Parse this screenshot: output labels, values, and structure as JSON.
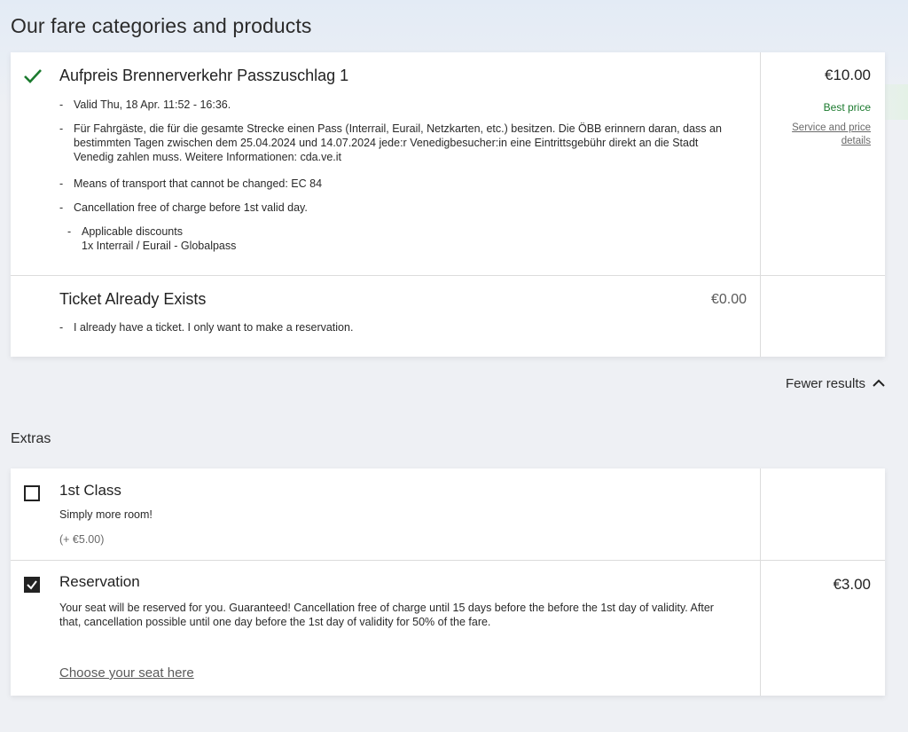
{
  "page": {
    "title": "Our fare categories and products"
  },
  "fares": [
    {
      "title": "Aufpreis Brennerverkehr Passzuschlag 1",
      "price": "€10.00",
      "badge": "Best price",
      "service_link_line1": "Service and price",
      "service_link_line2": "details",
      "details": [
        "Valid Thu, 18 Apr. 11:52 - 16:36.",
        "Für Fahrgäste, die für die gesamte Strecke einen Pass (Interrail, Eurail, Netzkarten, etc.) besitzen. Die ÖBB erinnern daran, dass an bestimmten Tagen zwischen dem 25.04.2024 und 14.07.2024 jede:r Venedigbesucher:in eine Eintrittsgebühr direkt an die Stadt Venedig zahlen muss. Weitere Informationen: cda.ve.it",
        "Means of transport that cannot be changed: EC 84",
        "Cancellation free of charge before 1st valid day."
      ],
      "discounts_label": "Applicable discounts",
      "discounts_value": "1x Interrail / Eurail - Globalpass",
      "selected": true
    },
    {
      "title": "Ticket Already Exists",
      "price": "€0.00",
      "details": [
        "I already have a ticket. I only want to make a reservation."
      ]
    }
  ],
  "toggle": {
    "fewer_label": "Fewer results"
  },
  "extras": {
    "title": "Extras",
    "items": [
      {
        "title": "1st Class",
        "subtitle": "Simply more room!",
        "surcharge": "(+ €5.00)",
        "checked": false
      },
      {
        "title": "Reservation",
        "price": "€3.00",
        "description": "Your seat will be reserved for you. Guaranteed! Cancellation free of charge until 15 days before the before the 1st day of validity. After that, cancellation possible until one day before the 1st day of validity for 50% of the fare.",
        "seat_link": "Choose your seat here",
        "checked": true
      }
    ]
  },
  "colors": {
    "accent_green": "#1b7a2e",
    "text_dark": "#222222"
  },
  "icons": {
    "selected": "checkmark-icon",
    "collapse": "chevron-up-icon",
    "unchecked": "checkbox-empty-icon",
    "checked": "checkbox-checked-icon"
  }
}
